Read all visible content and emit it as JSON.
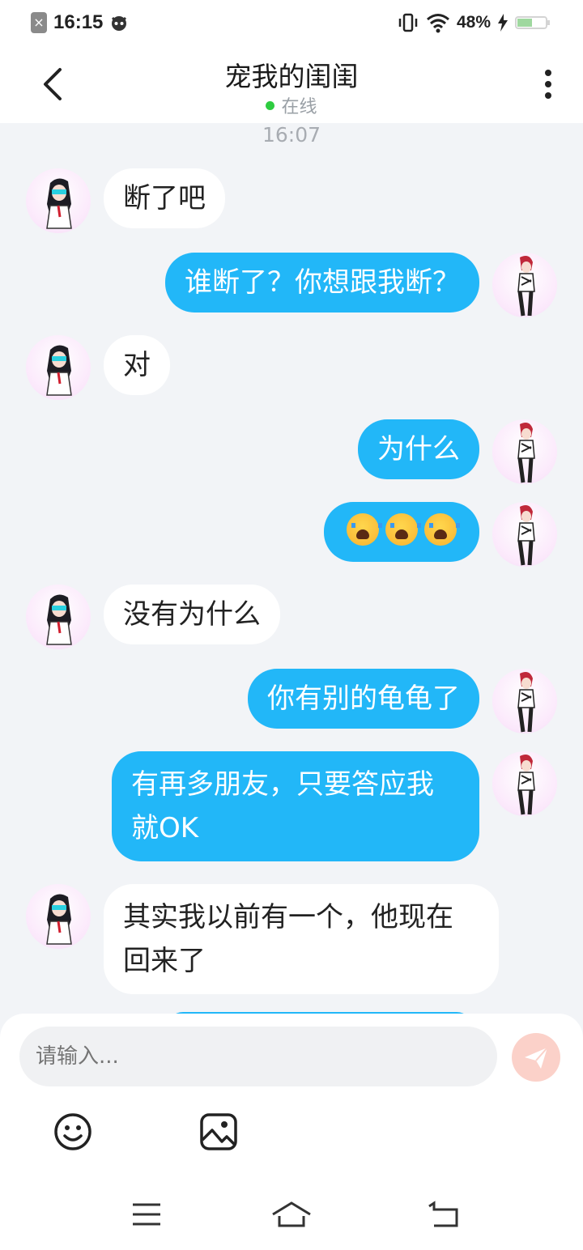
{
  "status_bar": {
    "time": "16:15",
    "battery": "48%"
  },
  "header": {
    "title": "宠我的闺闺",
    "status": "在线"
  },
  "chat": {
    "timestamp": "16:07",
    "messages": [
      {
        "side": "in",
        "text": "断了吧"
      },
      {
        "side": "out",
        "text": "谁断了？你想跟我断？"
      },
      {
        "side": "in",
        "text": "对"
      },
      {
        "side": "out",
        "text": "为什么"
      },
      {
        "side": "out",
        "text": "",
        "emoji": "loudly-crying-face",
        "emoji_count": 3
      },
      {
        "side": "in",
        "text": "没有为什么"
      },
      {
        "side": "out",
        "text": "你有别的龟龟了"
      },
      {
        "side": "out",
        "text": "有再多朋友，只要答应我就OK"
      },
      {
        "side": "in",
        "text": "其实我以前有一个，他现在回来了"
      }
    ]
  },
  "composer": {
    "placeholder": "请输入...",
    "send_icon": "send-icon",
    "emoji_icon": "smiley-icon",
    "image_icon": "image-icon",
    "send_color": "#fbd1c9"
  },
  "colors": {
    "outgoing_bubble": "#22b7f8",
    "incoming_bubble": "#ffffff",
    "background": "#f2f4f7"
  }
}
